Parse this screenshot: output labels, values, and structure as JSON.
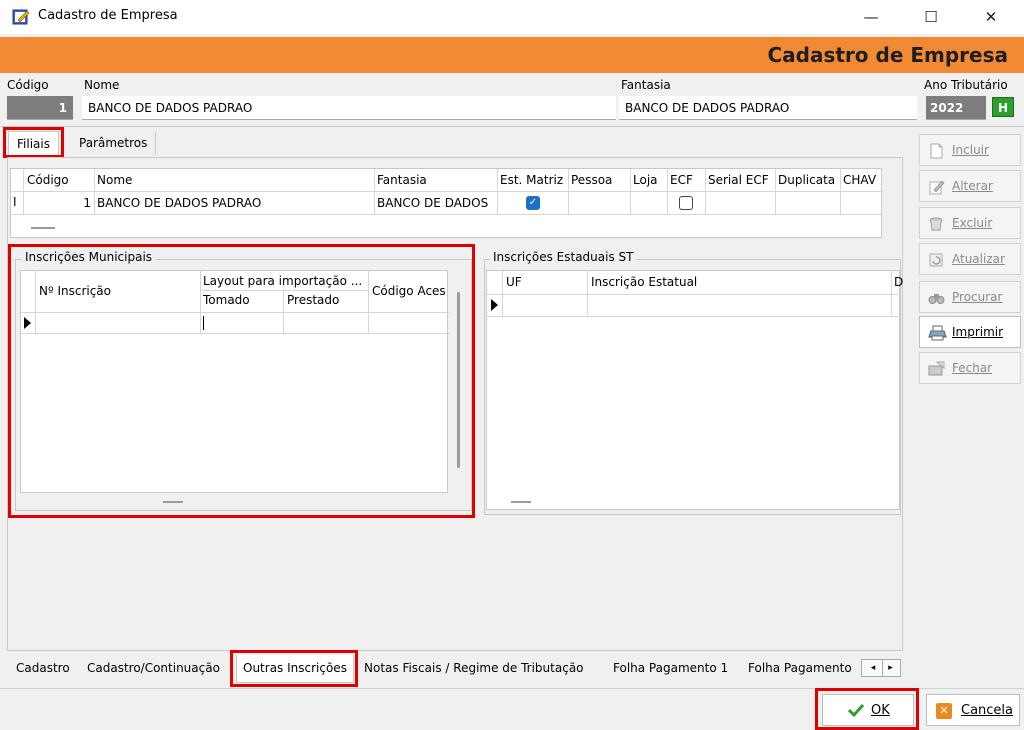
{
  "window": {
    "title": "Cadastro de Empresa",
    "minimize": "—",
    "maximize": "☐",
    "close": "✕"
  },
  "banner": {
    "title": "Cadastro de Empresa"
  },
  "fields": {
    "codigo_label": "Código",
    "codigo_value": "1",
    "nome_label": "Nome",
    "nome_value": "BANCO DE DADOS PADRAO",
    "fantasia_label": "Fantasia",
    "fantasia_value": "BANCO DE DADOS PADRAO",
    "ano_label": "Ano Tributário",
    "ano_value": "2022",
    "h_button": "H"
  },
  "top_tabs": [
    {
      "label": "Filiais",
      "selected": true
    },
    {
      "label": "Parâmetros",
      "selected": false
    }
  ],
  "filiais_grid": {
    "columns": [
      "Código",
      "Nome",
      "Fantasia",
      "Est. Matriz",
      "Pessoa",
      "Loja",
      "ECF",
      "Serial ECF",
      "Duplicata",
      "CHAV"
    ],
    "row": {
      "codigo": "1",
      "nome": "BANCO DE DADOS PADRAO",
      "fantasia": "BANCO DE DADOS",
      "est_matriz": true,
      "ecf": false
    },
    "row_indicator": "I"
  },
  "inscricoes_municipais": {
    "title": "Inscrições Municipais",
    "col_numero": "Nº Inscrição",
    "col_layout": "Layout para importação ...",
    "col_tomado": "Tomado",
    "col_prestado": "Prestado",
    "col_codigo_acesso": "Código Aces"
  },
  "inscricoes_estaduais": {
    "title": "Inscrições Estaduais ST",
    "col_uf": "UF",
    "col_inscricao": "Inscrição Estatual",
    "col_extra": "D"
  },
  "side_buttons": [
    {
      "label": "Incluir",
      "icon": "document-icon",
      "enabled": false
    },
    {
      "label": "Alterar",
      "icon": "edit-icon",
      "enabled": false
    },
    {
      "label": "Excluir",
      "icon": "trash-icon",
      "enabled": false
    },
    {
      "label": "Atualizar",
      "icon": "refresh-icon",
      "enabled": false
    },
    {
      "label": "Procurar",
      "icon": "binoculars-icon",
      "enabled": false
    },
    {
      "label": "Imprimir",
      "icon": "printer-icon",
      "enabled": true
    },
    {
      "label": "Fechar",
      "icon": "close-folder-icon",
      "enabled": false
    }
  ],
  "bottom_tabs": [
    {
      "label": "Cadastro"
    },
    {
      "label": "Cadastro/Continuação"
    },
    {
      "label": "Outras Inscrições",
      "selected": true
    },
    {
      "label": "Notas Fiscais / Regime de Tributação"
    },
    {
      "label": "Folha Pagamento 1"
    },
    {
      "label": "Folha Pagamento"
    }
  ],
  "footer": {
    "ok_label": "OK",
    "cancel_label": "Cancela"
  },
  "colors": {
    "banner": "#f28a34",
    "highlight": "#e00000",
    "checkbox_checked": "#1f6fc6"
  }
}
